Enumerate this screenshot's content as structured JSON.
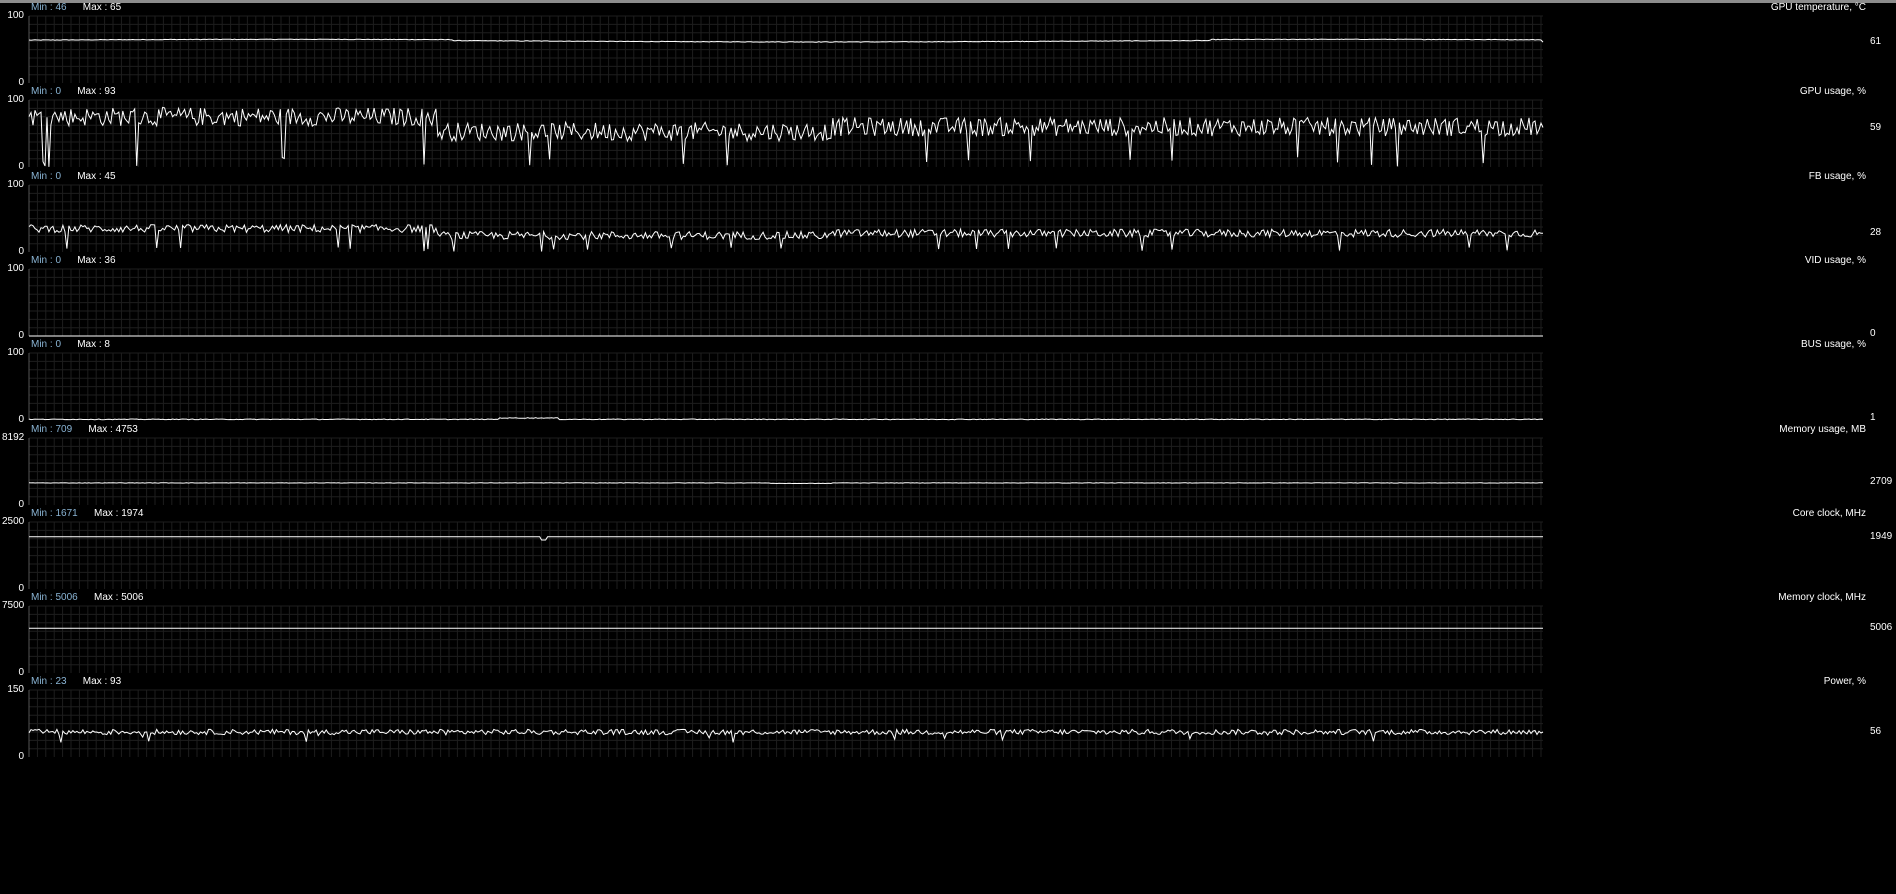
{
  "chart_data": [
    {
      "type": "line",
      "title": "GPU temperature, °C",
      "ylim": [
        0,
        100
      ],
      "tick_labels": [
        "100",
        "0"
      ],
      "min_label": "Min : 46",
      "max_label": "Max : 65",
      "current_label": "61",
      "min": 46,
      "max": 65,
      "current": 61,
      "pattern": "temp",
      "base": 64,
      "amp": 1.2
    },
    {
      "type": "line",
      "title": "GPU usage, %",
      "ylim": [
        0,
        100
      ],
      "tick_labels": [
        "100",
        "0"
      ],
      "min_label": "Min : 0",
      "max_label": "Max : 93",
      "current_label": "59",
      "min": 0,
      "max": 93,
      "current": 59,
      "pattern": "usage",
      "base": 60,
      "amp": 14
    },
    {
      "type": "line",
      "title": "FB usage, %",
      "ylim": [
        0,
        100
      ],
      "tick_labels": [
        "100",
        "0"
      ],
      "min_label": "Min : 0",
      "max_label": "Max : 45",
      "current_label": "28",
      "min": 0,
      "max": 45,
      "current": 28,
      "pattern": "usage",
      "base": 28,
      "amp": 6
    },
    {
      "type": "line",
      "title": "VID usage, %",
      "ylim": [
        0,
        100
      ],
      "tick_labels": [
        "100",
        "0"
      ],
      "min_label": "Min : 0",
      "max_label": "Max : 36",
      "current_label": "0",
      "min": 0,
      "max": 36,
      "current": 0,
      "pattern": "flat",
      "base": 0,
      "amp": 0
    },
    {
      "type": "line",
      "title": "BUS usage, %",
      "ylim": [
        0,
        100
      ],
      "tick_labels": [
        "100",
        "0"
      ],
      "min_label": "Min : 0",
      "max_label": "Max : 8",
      "current_label": "1",
      "min": 0,
      "max": 8,
      "current": 1,
      "pattern": "low",
      "base": 1,
      "amp": 1
    },
    {
      "type": "line",
      "title": "Memory usage, MB",
      "ylim": [
        0,
        8192
      ],
      "tick_labels": [
        "8192",
        "0"
      ],
      "min_label": "Min : 709",
      "max_label": "Max : 4753",
      "current_label": "2709",
      "min": 709,
      "max": 4753,
      "current": 2709,
      "pattern": "mem",
      "base": 2700,
      "amp": 40
    },
    {
      "type": "line",
      "title": "Core clock, MHz",
      "ylim": [
        0,
        2500
      ],
      "tick_labels": [
        "2500",
        "0"
      ],
      "min_label": "Min : 1671",
      "max_label": "Max : 1974",
      "current_label": "1949",
      "min": 1671,
      "max": 1974,
      "current": 1949,
      "pattern": "clock",
      "base": 1949,
      "amp": 0
    },
    {
      "type": "line",
      "title": "Memory clock, MHz",
      "ylim": [
        0,
        7500
      ],
      "tick_labels": [
        "7500",
        "0"
      ],
      "min_label": "Min : 5006",
      "max_label": "Max : 5006",
      "current_label": "5006",
      "min": 5006,
      "max": 5006,
      "current": 5006,
      "pattern": "flat",
      "base": 5006,
      "amp": 0
    },
    {
      "type": "line",
      "title": "Power, %",
      "ylim": [
        0,
        150
      ],
      "tick_labels": [
        "150",
        "0"
      ],
      "min_label": "Min : 23",
      "max_label": "Max : 93",
      "current_label": "56",
      "min": 23,
      "max": 93,
      "current": 56,
      "pattern": "power",
      "base": 56,
      "amp": 6
    }
  ]
}
